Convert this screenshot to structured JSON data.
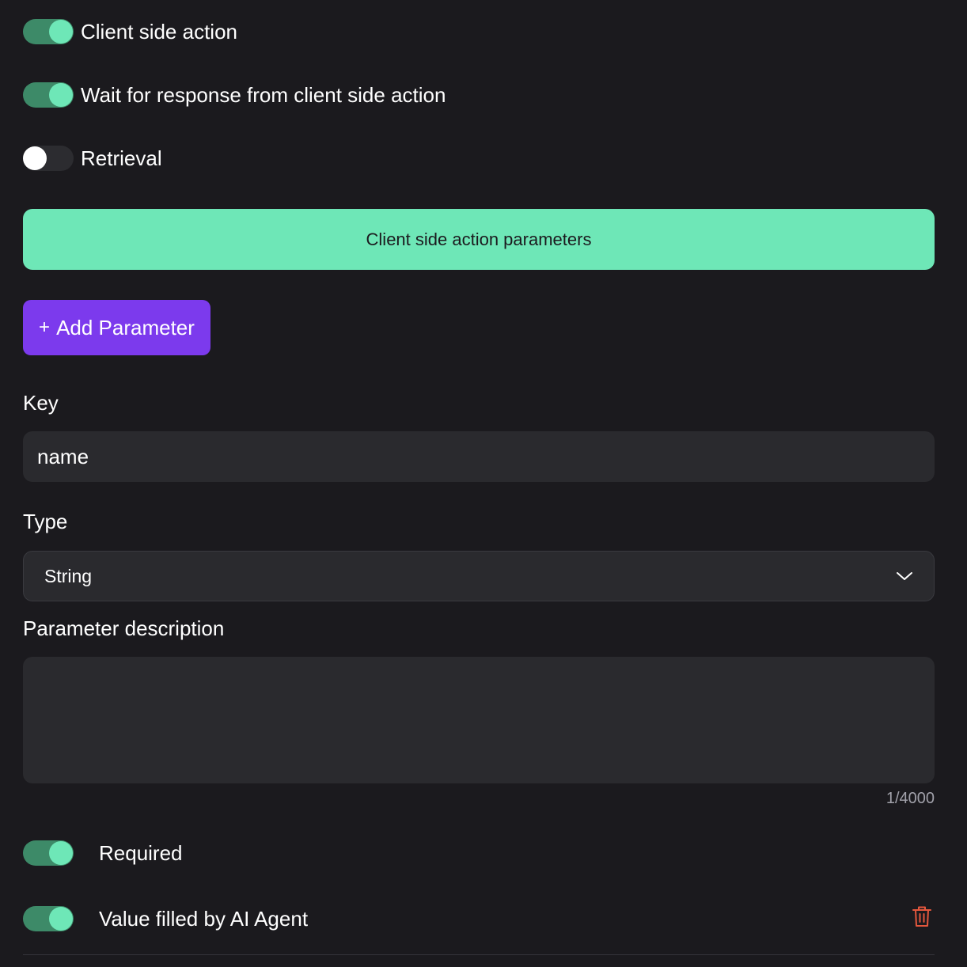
{
  "toggles": {
    "client_side_action": {
      "label": "Client side action",
      "state": "on"
    },
    "wait_for_response": {
      "label": "Wait for response from client side action",
      "state": "on"
    },
    "retrieval": {
      "label": "Retrieval",
      "state": "off"
    }
  },
  "parameters_section": {
    "title": "Client side action parameters",
    "add_button_label": "Add Parameter",
    "add_button_icon": "+"
  },
  "parameter": {
    "key_label": "Key",
    "key_value": "name",
    "type_label": "Type",
    "type_value": "String",
    "description_label": "Parameter description",
    "description_value": "",
    "description_counter": "1/4000",
    "required": {
      "label": "Required",
      "state": "on"
    },
    "ai_filled": {
      "label": "Value filled by AI Agent",
      "state": "on"
    },
    "delete_icon": "trash-icon"
  },
  "colors": {
    "background": "#1b1a1e",
    "accent_green": "#6ee7b7",
    "toggle_track_on": "#3d8a68",
    "primary_purple": "#7c3aed",
    "input_bg": "#2a2a2e",
    "danger": "#e4573d"
  }
}
